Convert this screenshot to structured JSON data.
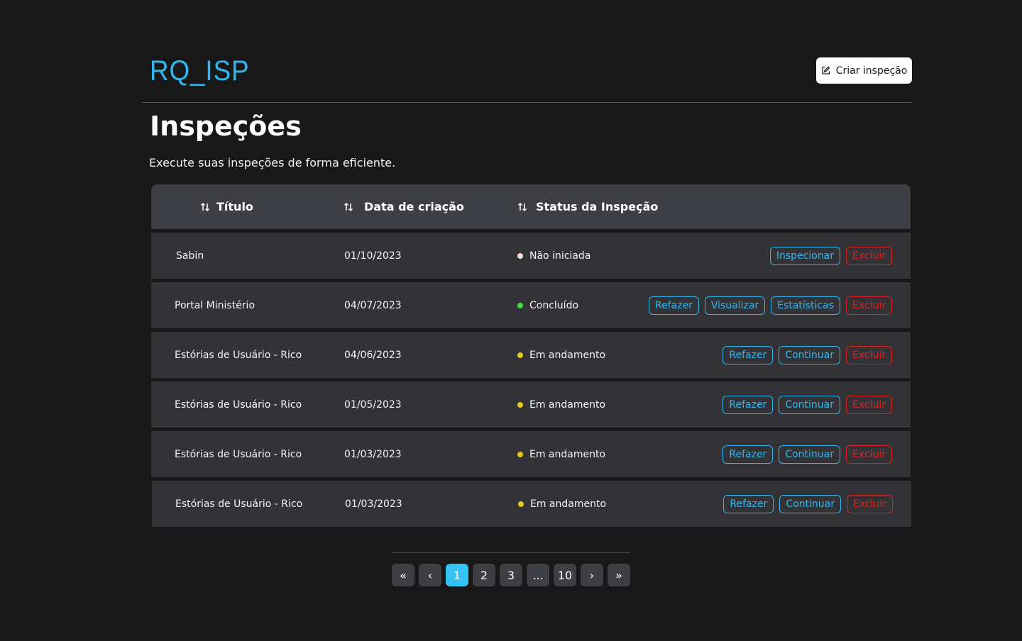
{
  "header": {
    "logo": "RQ_ISP",
    "create_button": "Criar inspeção"
  },
  "page": {
    "title": "Inspeções",
    "subtitle": "Execute suas inspeções de forma eficiente."
  },
  "table": {
    "columns": [
      "Título",
      "Data de criação",
      "Status da Inspeção"
    ],
    "rows": [
      {
        "title": "Sabin",
        "date": "01/10/2023",
        "status": "Não iniciada",
        "status_color": "#f6e1dc",
        "actions": [
          {
            "label": "Inspecionar",
            "variant": "blue"
          },
          {
            "label": "Excluir",
            "variant": "red"
          }
        ]
      },
      {
        "title": "Portal Ministério",
        "date": "04/07/2023",
        "status": "Concluído",
        "status_color": "#3ee03a",
        "actions": [
          {
            "label": "Refazer",
            "variant": "blue"
          },
          {
            "label": "Visualizar",
            "variant": "blue"
          },
          {
            "label": "Estatísticas",
            "variant": "blue"
          },
          {
            "label": "Excluir",
            "variant": "red"
          }
        ]
      },
      {
        "title": "Estórias de Usuário - Rico",
        "date": "04/06/2023",
        "status": "Em andamento",
        "status_color": "#e4c812",
        "actions": [
          {
            "label": "Refazer",
            "variant": "blue"
          },
          {
            "label": "Continuar",
            "variant": "blue"
          },
          {
            "label": "Excluir",
            "variant": "red"
          }
        ]
      },
      {
        "title": "Estórias de Usuário - Rico",
        "date": "01/05/2023",
        "status": "Em andamento",
        "status_color": "#e4c812",
        "actions": [
          {
            "label": "Refazer",
            "variant": "blue"
          },
          {
            "label": "Continuar",
            "variant": "blue"
          },
          {
            "label": "Excluir",
            "variant": "red"
          }
        ]
      },
      {
        "title": "Estórias de Usuário - Rico",
        "date": "01/03/2023",
        "status": "Em andamento",
        "status_color": "#e4c812",
        "actions": [
          {
            "label": "Refazer",
            "variant": "blue"
          },
          {
            "label": "Continuar",
            "variant": "blue"
          },
          {
            "label": "Excluir",
            "variant": "red"
          }
        ]
      },
      {
        "title": "Estórias de Usuário - Rico",
        "date": "01/03/2023",
        "status": "Em andamento",
        "status_color": "#e4c812",
        "actions": [
          {
            "label": "Refazer",
            "variant": "blue"
          },
          {
            "label": "Continuar",
            "variant": "blue"
          },
          {
            "label": "Excluir",
            "variant": "red"
          }
        ]
      }
    ]
  },
  "pagination": {
    "items": [
      "«",
      "‹",
      "1",
      "2",
      "3",
      "...",
      "10",
      "›",
      "»"
    ],
    "current": "1"
  },
  "colors": {
    "accent": "#2fb8ef",
    "danger": "#e0201d",
    "background": "#181819"
  }
}
